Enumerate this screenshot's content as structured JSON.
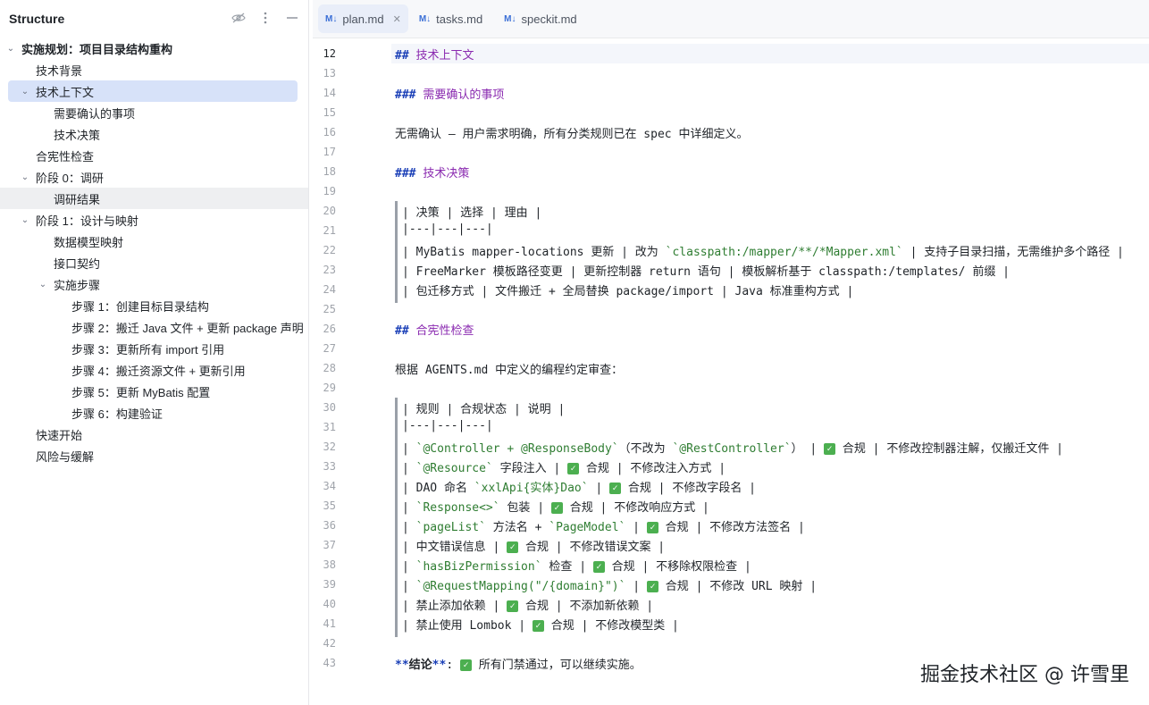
{
  "structure": {
    "title": "Structure",
    "items": [
      {
        "label": "实施规划：项目目录结构重构",
        "level": 0,
        "chev": "down",
        "bold": true
      },
      {
        "label": "技术背景",
        "level": 1
      },
      {
        "label": "技术上下文",
        "level": 1,
        "chev": "down",
        "selected": true
      },
      {
        "label": "需要确认的事项",
        "level": 2
      },
      {
        "label": "技术决策",
        "level": 2
      },
      {
        "label": "合宪性检查",
        "level": 1
      },
      {
        "label": "阶段 0：调研",
        "level": 1,
        "chev": "down"
      },
      {
        "label": "调研结果",
        "level": 2,
        "hover": true
      },
      {
        "label": "阶段 1：设计与映射",
        "level": 1,
        "chev": "down"
      },
      {
        "label": "数据模型映射",
        "level": 2
      },
      {
        "label": "接口契约",
        "level": 2
      },
      {
        "label": "实施步骤",
        "level": 2,
        "chev": "down"
      },
      {
        "label": "步骤 1：创建目标目录结构",
        "level": 3
      },
      {
        "label": "步骤 2：搬迁 Java 文件 + 更新 package 声明",
        "level": 3
      },
      {
        "label": "步骤 3：更新所有 import 引用",
        "level": 3
      },
      {
        "label": "步骤 4：搬迁资源文件 + 更新引用",
        "level": 3
      },
      {
        "label": "步骤 5：更新 MyBatis 配置",
        "level": 3
      },
      {
        "label": "步骤 6：构建验证",
        "level": 3
      },
      {
        "label": "快速开始",
        "level": 1
      },
      {
        "label": "风险与缓解",
        "level": 1
      }
    ]
  },
  "tabs": [
    {
      "label": "plan.md",
      "active": true,
      "icon": "M↓"
    },
    {
      "label": "tasks.md",
      "icon": "M↓"
    },
    {
      "label": "speckit.md",
      "icon": "M↓"
    }
  ],
  "editor": {
    "lines": [
      {
        "n": "12",
        "kind": "h",
        "marker": "##",
        "text": "技术上下文",
        "current": true
      },
      {
        "n": "13",
        "kind": "blank"
      },
      {
        "n": "14",
        "kind": "h",
        "marker": "###",
        "text": "需要确认的事项"
      },
      {
        "n": "15",
        "kind": "blank"
      },
      {
        "n": "16",
        "kind": "text",
        "text": "无需确认 — 用户需求明确，所有分类规则已在 spec 中详细定义。"
      },
      {
        "n": "17",
        "kind": "blank"
      },
      {
        "n": "18",
        "kind": "h",
        "marker": "###",
        "text": "技术决策"
      },
      {
        "n": "19",
        "kind": "blank"
      },
      {
        "n": "20",
        "kind": "tbl",
        "text": "| 决策 | 选择 | 理由 |"
      },
      {
        "n": "21",
        "kind": "tbl",
        "text": "|---|---|---|"
      },
      {
        "n": "22",
        "kind": "tbl",
        "text": "| MyBatis mapper-locations 更新 | 改为 `classpath:/mapper/**/*Mapper.xml` | 支持子目录扫描，无需维护多个路径 |"
      },
      {
        "n": "23",
        "kind": "tbl",
        "text": "| FreeMarker 模板路径变更 | 更新控制器 return 语句 | 模板解析基于 classpath:/templates/ 前缀 |"
      },
      {
        "n": "24",
        "kind": "tbl",
        "text": "| 包迁移方式 | 文件搬迁 + 全局替换 package/import | Java 标准重构方式 |"
      },
      {
        "n": "25",
        "kind": "blank"
      },
      {
        "n": "26",
        "kind": "h",
        "marker": "##",
        "text": "合宪性检查"
      },
      {
        "n": "27",
        "kind": "blank"
      },
      {
        "n": "28",
        "kind": "text",
        "text": "根据 AGENTS.md 中定义的编程约定审查："
      },
      {
        "n": "29",
        "kind": "blank"
      },
      {
        "n": "30",
        "kind": "tbl",
        "text": "| 规则 | 合规状态 | 说明 |"
      },
      {
        "n": "31",
        "kind": "tbl",
        "text": "|---|---|---|"
      },
      {
        "n": "32",
        "kind": "tbl",
        "text": "| `@Controller + @ResponseBody`（不改为 `@RestController`） | ✅ 合规 | 不修改控制器注解，仅搬迁文件 |"
      },
      {
        "n": "33",
        "kind": "tbl",
        "text": "| `@Resource` 字段注入 | ✅ 合规 | 不修改注入方式 |"
      },
      {
        "n": "34",
        "kind": "tbl",
        "text": "| DAO 命名 `xxlApi{实体}Dao` | ✅ 合规 | 不修改字段名 |"
      },
      {
        "n": "35",
        "kind": "tbl",
        "text": "| `Response<>` 包装 | ✅ 合规 | 不修改响应方式 |"
      },
      {
        "n": "36",
        "kind": "tbl",
        "text": "| `pageList` 方法名 + `PageModel` | ✅ 合规 | 不修改方法签名 |"
      },
      {
        "n": "37",
        "kind": "tbl",
        "text": "| 中文错误信息 | ✅ 合规 | 不修改错误文案 |"
      },
      {
        "n": "38",
        "kind": "tbl",
        "text": "| `hasBizPermission` 检查 | ✅ 合规 | 不移除权限检查 |"
      },
      {
        "n": "39",
        "kind": "tbl",
        "text": "| `@RequestMapping(\"/{domain}\")` | ✅ 合规 | 不修改 URL 映射 |"
      },
      {
        "n": "40",
        "kind": "tbl",
        "text": "| 禁止添加依赖 | ✅ 合规 | 不添加新依赖 |"
      },
      {
        "n": "41",
        "kind": "tbl",
        "text": "| 禁止使用 Lombok | ✅ 合规 | 不修改模型类 |"
      },
      {
        "n": "42",
        "kind": "blank"
      },
      {
        "n": "43",
        "kind": "text",
        "text": "**结论**: ✅ 所有门禁通过，可以继续实施。"
      }
    ]
  },
  "watermark": "掘金技术社区 @ 许雪里",
  "colors": {
    "accent": "#3b6fd6",
    "selected": "#d7e2f9",
    "header": "#1a3fb7",
    "header_text": "#8a2ab0",
    "check": "#4caf50"
  }
}
